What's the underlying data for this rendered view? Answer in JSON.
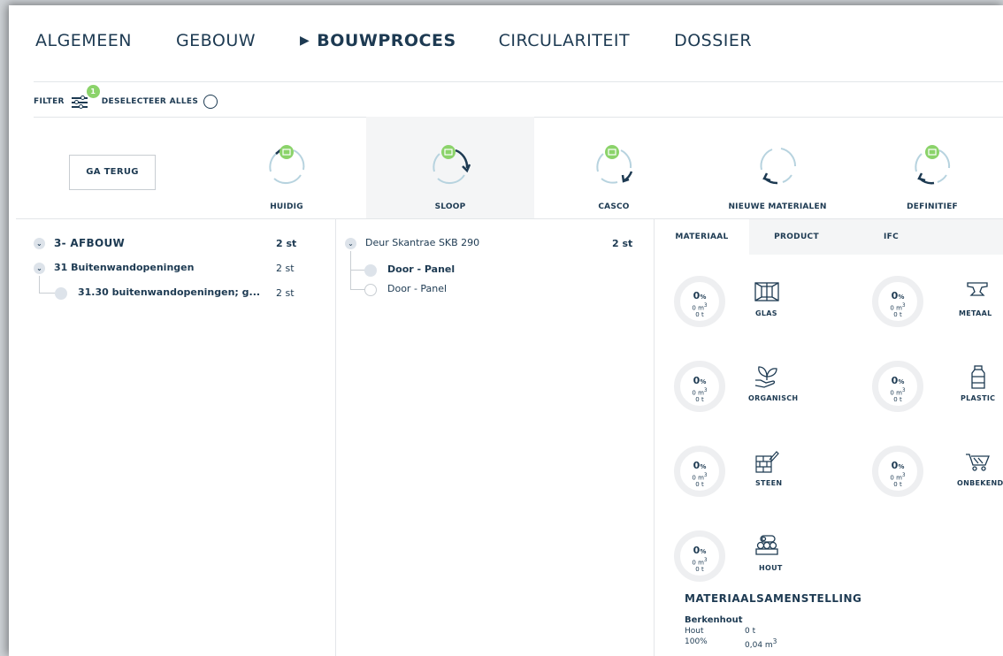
{
  "nav": {
    "tabs": [
      "ALGEMEEN",
      "GEBOUW",
      "BOUWPROCES",
      "CIRCULARITEIT",
      "DOSSIER"
    ],
    "active": "BOUWPROCES"
  },
  "filterbar": {
    "filter_label": "FILTER",
    "filter_count": "1",
    "deselect_label": "DESELECTEER ALLES"
  },
  "back_button": "GA TERUG",
  "phases": [
    {
      "label": "HUIDIG"
    },
    {
      "label": "SLOOP"
    },
    {
      "label": "CASCO"
    },
    {
      "label": "NIEUWE MATERIALEN"
    },
    {
      "label": "DEFINITIEF"
    }
  ],
  "tree": {
    "r1": {
      "label": "3- AFBOUW",
      "qty": "2 st"
    },
    "r2": {
      "label": "31 Buitenwandopeningen",
      "qty": "2 st"
    },
    "r3": {
      "label": "31.30 buitenwandopeningen; g...",
      "qty": "2 st"
    }
  },
  "elements": {
    "header": {
      "label": "Deur Skantrae SKB 290",
      "qty": "2 st"
    },
    "items": [
      {
        "label": "Door - Panel"
      },
      {
        "label": "Door - Panel"
      }
    ]
  },
  "detail_tabs": [
    "MATERIAAL",
    "PRODUCT",
    "IFC"
  ],
  "materials": [
    {
      "name": "GLAS",
      "pct": "0",
      "vol": "0 m",
      "mass": "0 t",
      "icon": "glass-icon"
    },
    {
      "name": "METAAL",
      "pct": "0",
      "vol": "0 m",
      "mass": "0 t",
      "icon": "metal-icon"
    },
    {
      "name": "ORGANISCH",
      "pct": "0",
      "vol": "0 m",
      "mass": "0 t",
      "icon": "organic-icon"
    },
    {
      "name": "PLASTIC",
      "pct": "0",
      "vol": "0 m",
      "mass": "0 t",
      "icon": "plastic-icon"
    },
    {
      "name": "STEEN",
      "pct": "0",
      "vol": "0 m",
      "mass": "0 t",
      "icon": "stone-icon"
    },
    {
      "name": "ONBEKEND",
      "pct": "0",
      "vol": "0 m",
      "mass": "0 t",
      "icon": "unknown-icon"
    },
    {
      "name": "HOUT",
      "pct": "0",
      "vol": "0 m",
      "mass": "0 t",
      "icon": "wood-icon"
    }
  ],
  "pct_sign": "%",
  "composition": {
    "title": "MATERIAALSAMENSTELLING",
    "name": "Berkenhout",
    "material": "Hout",
    "mass": "0 t",
    "pct": "100%",
    "volume": "0,04 m"
  },
  "colors": {
    "text": "#1d3a52",
    "badge": "#8bd36a",
    "ring": "#eeeff1"
  }
}
